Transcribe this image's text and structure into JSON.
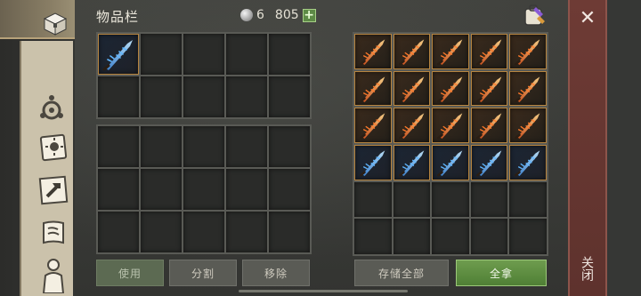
{
  "header": {
    "title": "物品栏",
    "currency_amount": "6",
    "currency_total": "805",
    "add_label": "+"
  },
  "left_tabs": [
    {
      "icon": "chest-icon"
    },
    {
      "icon": "compass-icon"
    },
    {
      "icon": "sun-book-icon"
    },
    {
      "icon": "hammer-icon"
    },
    {
      "icon": "map-scroll-icon"
    },
    {
      "icon": "character-icon"
    }
  ],
  "inventory": {
    "top_grid": {
      "rows": 2,
      "cols": 5,
      "items": [
        {
          "slot": 0,
          "type": "ice-sword-icon"
        }
      ]
    },
    "bottom_grid": {
      "rows": 3,
      "cols": 5,
      "items": []
    }
  },
  "container": {
    "rows": 6,
    "cols": 5,
    "items_fire": 15,
    "items_ice": 5
  },
  "buttons": {
    "use": "使用",
    "split": "分割",
    "remove": "移除",
    "store_all": "存储全部",
    "take_all": "全拿"
  },
  "close": {
    "icon": "close-icon",
    "label": "关闭"
  },
  "colors": {
    "accent_green": "#5d8a46",
    "close_panel": "#6e3b35",
    "item_border": "#b6843f"
  }
}
